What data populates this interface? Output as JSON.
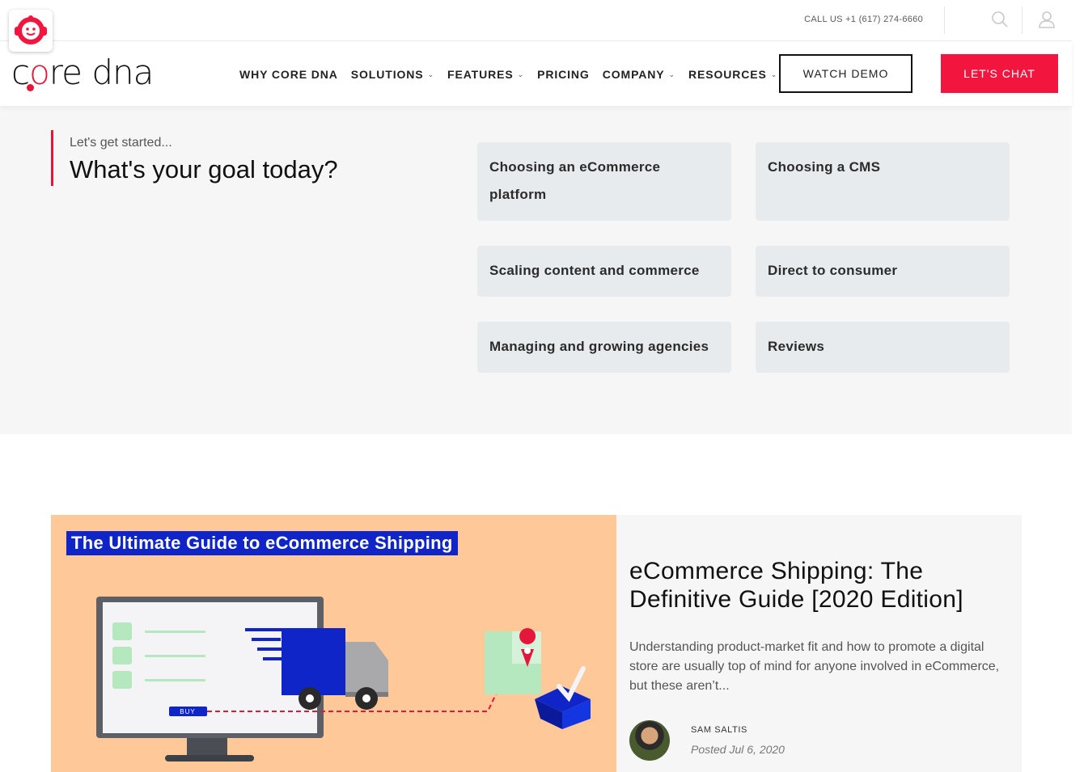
{
  "topbar": {
    "call_label": "CALL US +1 (617) 274-6660",
    "search_icon": "search-icon",
    "user_icon": "user-icon"
  },
  "header": {
    "logo_text": {
      "part1": "c",
      "part2": "o",
      "part3": "re dna"
    },
    "nav": [
      {
        "label": "WHY CORE DNA",
        "dropdown": false
      },
      {
        "label": "SOLUTIONS",
        "dropdown": true
      },
      {
        "label": "FEATURES",
        "dropdown": true
      },
      {
        "label": "PRICING",
        "dropdown": false
      },
      {
        "label": "COMPANY",
        "dropdown": true
      },
      {
        "label": "RESOURCES",
        "dropdown": true
      }
    ],
    "watch_demo": "WATCH DEMO",
    "lets_chat": "LET'S CHAT",
    "accent": "#f2163f"
  },
  "goal": {
    "subtitle": "Let's get started...",
    "title": "What's your goal today?",
    "options": [
      "Choosing an eCommerce platform",
      "Choosing a CMS",
      "Scaling content and commerce",
      "Direct to consumer",
      "Managing and growing agencies",
      "Reviews"
    ]
  },
  "feature": {
    "image_title": "The Ultimate Guide to eCommerce Shipping",
    "image_buy_label": "BUY",
    "title": "eCommerce Shipping: The Definitive Guide [2020 Edition]",
    "excerpt": "Understanding product-market fit and how to promote a digital store are usually top of mind for anyone involved in eCommerce, but these aren’t...",
    "author": "SAM SALTIS",
    "date": "Posted Jul 6, 2020"
  }
}
